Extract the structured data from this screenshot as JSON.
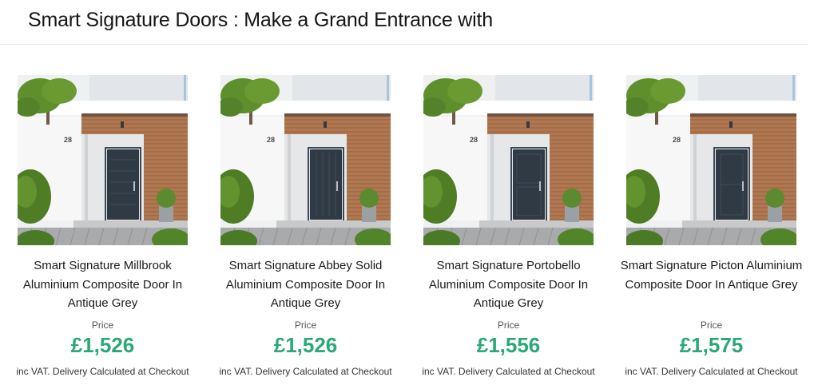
{
  "page": {
    "title": "Smart Signature Doors : Make a Grand Entrance with"
  },
  "products": [
    {
      "name": "Smart Signature Millbrook Aluminium Composite Door In Antique Grey",
      "price_label": "Price",
      "price": "£1,526",
      "vat_note": "inc VAT. Delivery Calculated at Checkout",
      "house_number": "28",
      "door_style": "millbrook"
    },
    {
      "name": "Smart Signature Abbey Solid Aluminium Composite Door In Antique Grey",
      "price_label": "Price",
      "price": "£1,526",
      "vat_note": "inc VAT. Delivery Calculated at Checkout",
      "house_number": "28",
      "door_style": "abbey"
    },
    {
      "name": "Smart Signature Portobello Aluminium Composite Door In Antique Grey",
      "price_label": "Price",
      "price": "£1,556",
      "vat_note": "inc VAT. Delivery Calculated at Checkout",
      "house_number": "28",
      "door_style": "portobello"
    },
    {
      "name": "Smart Signature Picton Aluminium Composite Door In Antique Grey",
      "price_label": "Price",
      "price": "£1,575",
      "vat_note": "inc VAT. Delivery Calculated at Checkout",
      "house_number": "28",
      "door_style": "picton"
    }
  ],
  "colors": {
    "price": "#2aa876",
    "door": "#2f3a44",
    "wood": "#b07850",
    "foliage": "#5f8f2c"
  }
}
